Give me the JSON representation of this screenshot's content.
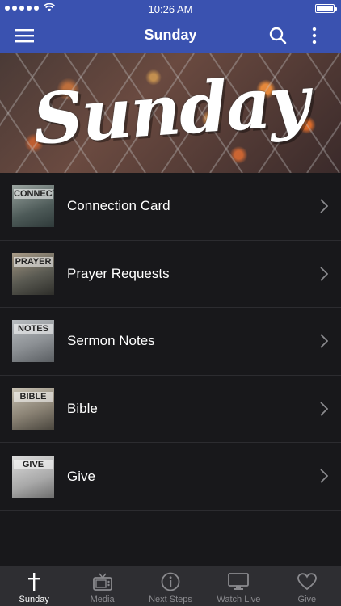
{
  "status_bar": {
    "time": "10:26 AM"
  },
  "header": {
    "title": "Sunday"
  },
  "hero": {
    "text": "Sunday"
  },
  "items": [
    {
      "label": "Connection Card",
      "thumb_text": "CONNECT"
    },
    {
      "label": "Prayer Requests",
      "thumb_text": "PRAYER"
    },
    {
      "label": "Sermon Notes",
      "thumb_text": "NOTES"
    },
    {
      "label": "Bible",
      "thumb_text": "BIBLE"
    },
    {
      "label": "Give",
      "thumb_text": "GIVE"
    }
  ],
  "tabs": [
    {
      "label": "Sunday",
      "icon": "cross-icon",
      "active": true
    },
    {
      "label": "Media",
      "icon": "tv-icon",
      "active": false
    },
    {
      "label": "Next Steps",
      "icon": "info-icon",
      "active": false
    },
    {
      "label": "Watch Live",
      "icon": "monitor-icon",
      "active": false
    },
    {
      "label": "Give",
      "icon": "heart-icon",
      "active": false
    }
  ],
  "colors": {
    "accent": "#3a52b0",
    "background": "#18181b",
    "tabbar": "#2e2e32"
  }
}
